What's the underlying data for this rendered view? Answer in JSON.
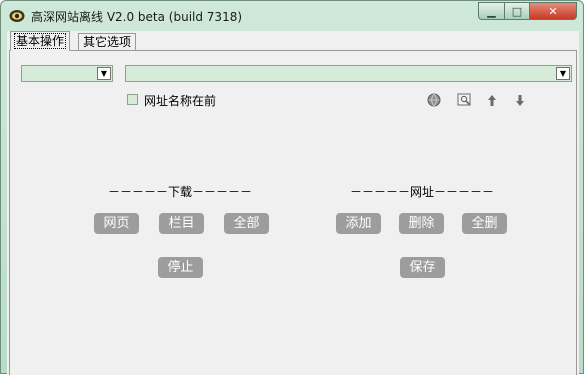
{
  "window": {
    "title": "高深网站离线 V2.0 beta (build 7318)",
    "app_icon": "eye-icon",
    "minimize_glyph": "▁",
    "maximize_glyph": "□",
    "close_glyph": "✕"
  },
  "tabs": [
    {
      "label": "基本操作",
      "active": true
    },
    {
      "label": "其它选项",
      "active": false
    }
  ],
  "toolbar": {
    "left_combo_value": "",
    "url_combo_value": "",
    "checkbox": {
      "label": "网址名称在前",
      "checked": false
    },
    "icons": [
      "globe-icon",
      "preview-icon",
      "up-arrow-icon",
      "down-arrow-icon"
    ]
  },
  "download_section": {
    "label": "－－－－－下载－－－－－",
    "buttons": {
      "web": "网页",
      "column": "栏目",
      "all": "全部",
      "stop": "停止"
    }
  },
  "url_section": {
    "label": "－－－－－网址－－－－－",
    "buttons": {
      "add": "添加",
      "delete": "删除",
      "delete_all": "全删",
      "save": "保存"
    }
  },
  "colors": {
    "button_bg": "#9d9d9d",
    "combo_bg": "#d6ecd9",
    "panel_bg": "#f0f0f0"
  }
}
